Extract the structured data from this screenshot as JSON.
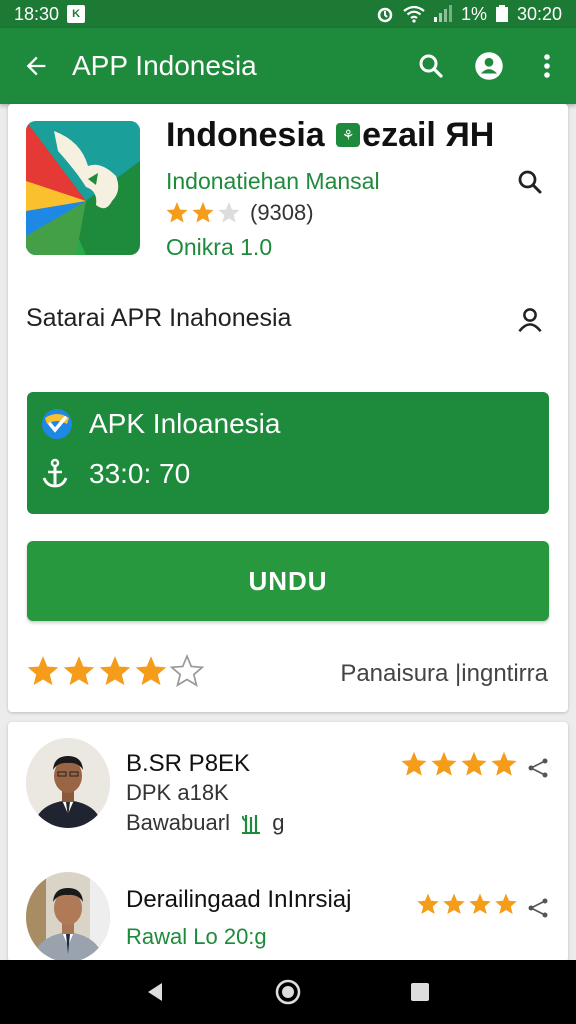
{
  "status_bar": {
    "time": "18:30",
    "notif_icon_text": "K",
    "battery": "1%",
    "clock_right": "30:20"
  },
  "app_bar": {
    "title": "APP Indonesia"
  },
  "app": {
    "name_part1": "Indonesia",
    "name_part2": "ezail ЯН",
    "developer": "Indonatiehan Mansal",
    "rating_text": "(9308)",
    "rating": 2.5,
    "version": "Onikra 1.0"
  },
  "section": {
    "title": "Satarai APR Inahonesia"
  },
  "apk": {
    "name": "APK Inloanesia",
    "size": "33:0: 70"
  },
  "download_label": "UNDU",
  "rate": {
    "stars": 4,
    "label": "Panaisura |ingntirra"
  },
  "reviews": [
    {
      "name": "B.SR P8EK",
      "sub": "DPK a18K",
      "meta": "Bawabuarl",
      "meta_extra": "g",
      "stars": 4
    },
    {
      "name": "Derailingaad InInrsiaj",
      "meta": "Rawal Lo  20:g",
      "stars": 4
    }
  ],
  "colors": {
    "primary": "#1e8a3c",
    "status": "#1c7a35",
    "button": "#28983f",
    "star": "#f59c1a"
  }
}
